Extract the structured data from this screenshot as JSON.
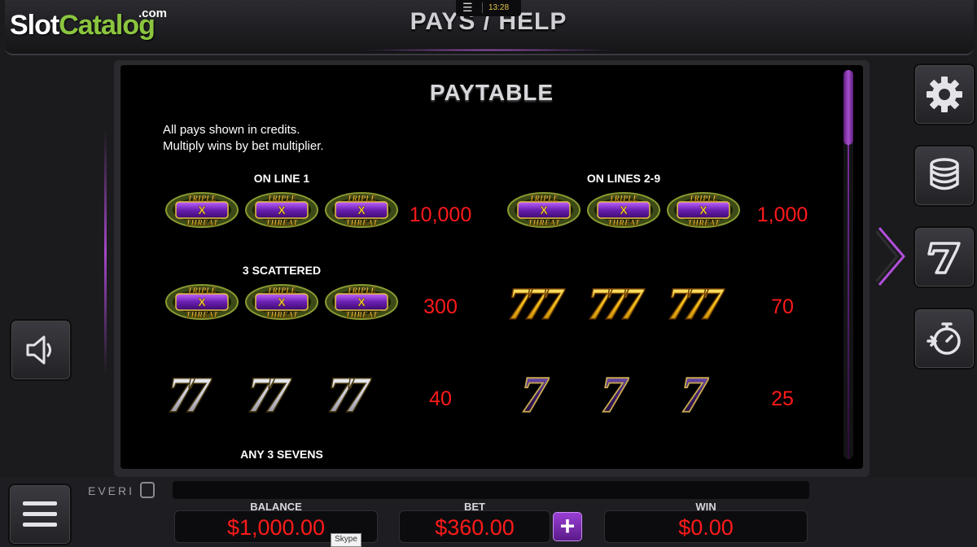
{
  "header": {
    "logo_slot": "Slot",
    "logo_catalog": "Catalog",
    "logo_com": ".com",
    "title": "PAYS / HELP",
    "clock": "13:28"
  },
  "paytable": {
    "title": "PAYTABLE",
    "intro_line1": "All pays shown in credits.",
    "intro_line2": "Multiply wins by bet multiplier.",
    "label_line1": "ON LINE 1",
    "label_lines29": "ON LINES 2-9",
    "label_scattered": "3 SCATTERED",
    "label_any_sevens": "ANY 3 SEVENS",
    "rows": [
      {
        "symbol": "triple-threat",
        "pay": "10,000"
      },
      {
        "symbol": "triple-threat",
        "pay": "1,000"
      },
      {
        "symbol": "triple-threat",
        "pay": "300"
      },
      {
        "symbol": "gold-triple-seven",
        "pay": "70"
      },
      {
        "symbol": "silver-double-seven",
        "pay": "40"
      },
      {
        "symbol": "purple-seven",
        "pay": "25"
      }
    ]
  },
  "footer": {
    "brand": "EVERI",
    "balance_label": "BALANCE",
    "balance_value": "$1,000.00",
    "bet_label": "BET",
    "bet_value": "$360.00",
    "win_label": "WIN",
    "win_value": "$0.00",
    "plus": "+",
    "skype": "Skype"
  },
  "nav_icons": [
    "gear-icon",
    "coins-stack-icon",
    "seven-icon",
    "stopwatch-icon"
  ],
  "colors": {
    "pay_red": "#ff1a1a",
    "accent_purple": "#a347c8",
    "logo_green": "#8bc53f"
  }
}
